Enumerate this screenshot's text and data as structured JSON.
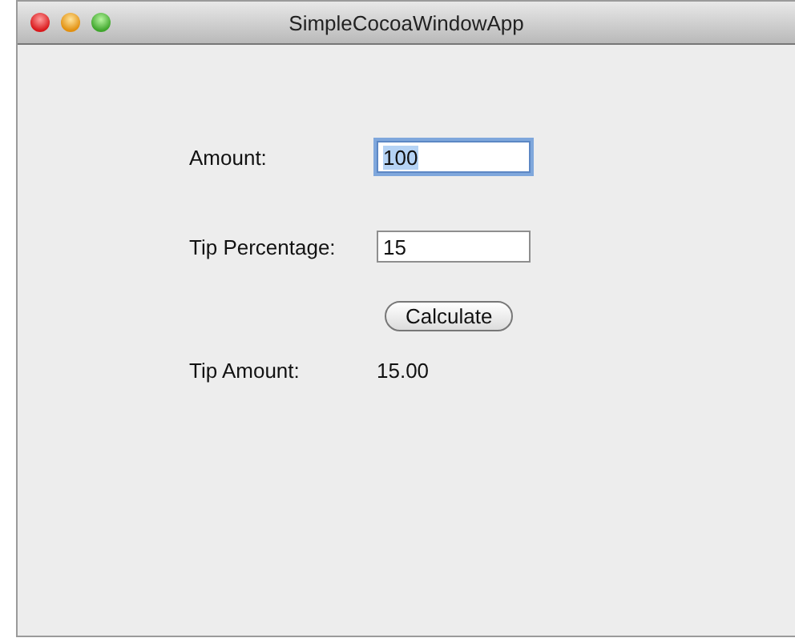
{
  "window": {
    "title": "SimpleCocoaWindowApp"
  },
  "fields": [
    {
      "label": "Amount:",
      "value": "100",
      "focused": true
    },
    {
      "label": "Tip Percentage:",
      "value": "15",
      "focused": false
    }
  ],
  "button": {
    "label": "Calculate"
  },
  "result": {
    "label": "Tip Amount:",
    "value": "15.00"
  }
}
